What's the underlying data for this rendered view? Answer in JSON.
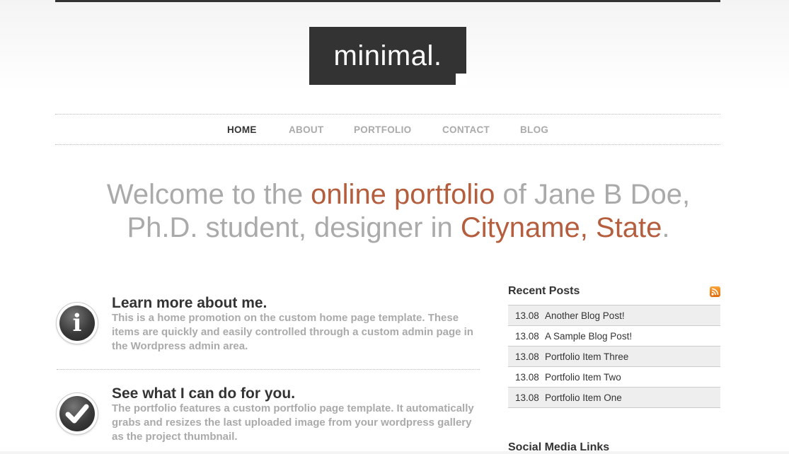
{
  "site": {
    "logo_text": "minimal."
  },
  "nav": {
    "items": [
      {
        "label": "HOME",
        "active": true
      },
      {
        "label": "ABOUT"
      },
      {
        "label": "PORTFOLIO"
      },
      {
        "label": "CONTACT"
      },
      {
        "label": "BLOG"
      }
    ]
  },
  "welcome": {
    "part1": "Welcome to the ",
    "highlight1": "online portfolio",
    "part2": " of Jane B Doe,",
    "part3": "Ph.D. student, designer in ",
    "highlight2": "Cityname, State",
    "part4": "."
  },
  "promos": [
    {
      "title": "Learn more about me.",
      "text": "This is a home promotion on the custom home page template. These items are quickly and easily controlled through a custom admin page in the Wordpress admin area.",
      "icon": "info-icon"
    },
    {
      "title": "See what I can do for you.",
      "text": "The portfolio features a custom portfolio page template. It automatically grabs and resizes the last uploaded image from your wordpress gallery as the project thumbnail.",
      "icon": "checkmark-icon"
    }
  ],
  "sidebar": {
    "recent_posts_title": "Recent Posts",
    "posts": [
      {
        "date": "13.08",
        "title": "Another Blog Post!"
      },
      {
        "date": "13.08",
        "title": "A Sample Blog Post!"
      },
      {
        "date": "13.08",
        "title": "Portfolio Item Three"
      },
      {
        "date": "13.08",
        "title": "Portfolio Item Two"
      },
      {
        "date": "13.08",
        "title": "Portfolio Item One"
      }
    ],
    "social_title": "Social Media Links"
  },
  "colors": {
    "accent": "#b55e3e",
    "dark": "#333333",
    "muted": "#aaaaaa",
    "row_alt": "#eeeeee",
    "rss": "#f28a1e"
  }
}
